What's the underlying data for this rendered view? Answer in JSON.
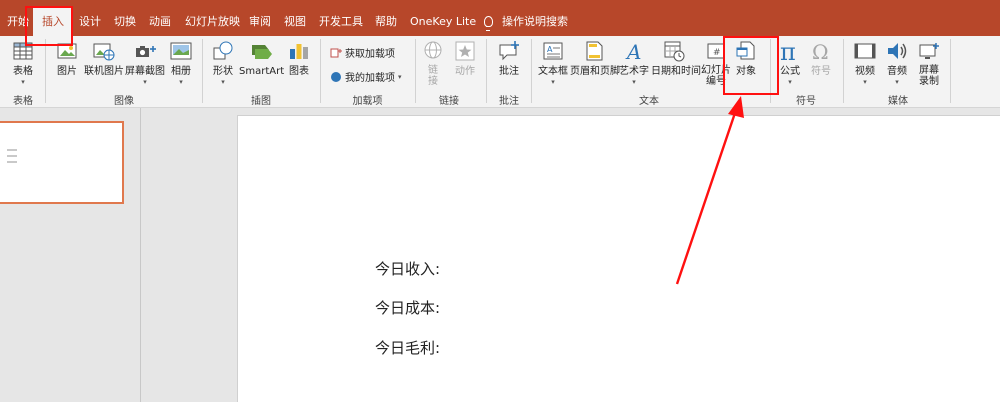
{
  "tabs": [
    "开始",
    "插入",
    "设计",
    "切换",
    "动画",
    "幻灯片放映",
    "审阅",
    "视图",
    "开发工具",
    "帮助",
    "OneKey Lite"
  ],
  "tell_me": "操作说明搜索",
  "ribbon": {
    "table": {
      "label": "表格",
      "group": "表格"
    },
    "images": {
      "picture": "图片",
      "online_picture": "联机图片",
      "screenshot": "屏幕截图",
      "album": "相册",
      "group": "图像"
    },
    "illustrations": {
      "shapes": "形状",
      "smartart": "SmartArt",
      "chart": "图表",
      "group": "插图"
    },
    "addins": {
      "get": "获取加载项",
      "mine": "我的加载项",
      "group": "加载项"
    },
    "links": {
      "link_line1": "链",
      "link_line2": "接",
      "action": "动作",
      "group": "链接"
    },
    "comments": {
      "comment": "批注",
      "group": "批注"
    },
    "text": {
      "textbox": "文本框",
      "header_footer": "页眉和页脚",
      "wordart": "艺术字",
      "datetime": "日期和时间",
      "slide_number_line1": "幻灯片",
      "slide_number_line2": "编号",
      "object": "对象",
      "group": "文本"
    },
    "symbols": {
      "equation": "公式",
      "symbol": "符号",
      "group": "符号"
    },
    "media": {
      "video": "视频",
      "audio": "音频",
      "screen_rec_line1": "屏幕",
      "screen_rec_line2": "录制",
      "group": "媒体"
    }
  },
  "slide": {
    "line1": "今日收入:",
    "line2": "今日成本:",
    "line3": "今日毛利:"
  },
  "colors": {
    "accent": "#b7472a",
    "highlight": "#ff1010",
    "thumb_border": "#e0784d"
  }
}
